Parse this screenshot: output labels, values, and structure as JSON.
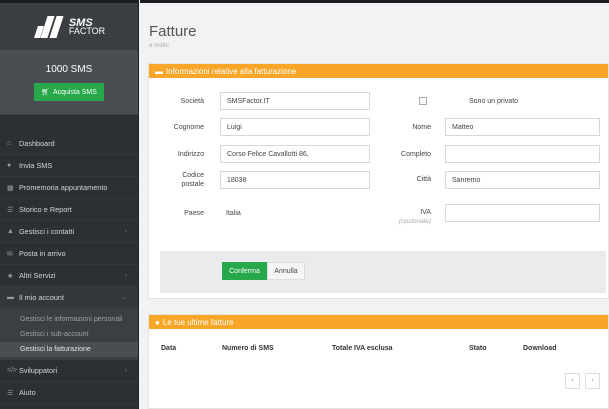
{
  "brand": {
    "line1": "SMS",
    "line2": "FACTOR"
  },
  "credits": {
    "count": "1000 SMS",
    "buy_label": "Acquista SMS"
  },
  "nav": [
    {
      "label": "Dashboard",
      "icon": "home-icon"
    },
    {
      "label": "Invia SMS",
      "icon": "chat-icon"
    },
    {
      "label": "Promemoria appuntamento",
      "icon": "calendar-icon"
    },
    {
      "label": "Storico e Report",
      "icon": "list-icon"
    },
    {
      "label": "Gestisci i contatti",
      "icon": "user-icon"
    },
    {
      "label": "Posta in arrivo",
      "icon": "mail-icon"
    },
    {
      "label": "Altri Servizi",
      "icon": "star-icon"
    },
    {
      "label": "Il mio account",
      "icon": "card-icon"
    }
  ],
  "subnav": [
    {
      "label": "Gestisci le informazioni personali"
    },
    {
      "label": "Gestisci i sub-account"
    },
    {
      "label": "Gestisci la fatturazione"
    }
  ],
  "nav_bottom": [
    {
      "label": "Sviluppatori",
      "icon": "code-icon"
    },
    {
      "label": "Aiuto",
      "icon": "help-icon"
    }
  ],
  "page": {
    "title": "Fatture",
    "subtitle": "e ordini"
  },
  "billing": {
    "header": "Informazioni relative alla fatturazione",
    "societa_label": "Società",
    "societa_value": "SMSFactor.IT",
    "privato_label": "Sono un privato",
    "cognome_label": "Cognome",
    "cognome_value": "Luigi",
    "nome_label": "Nome",
    "nome_value": "Matteo",
    "indirizzo_label": "Indirizzo",
    "indirizzo_value": "Corso Felice Cavallotti 86,",
    "completo_label": "Completo",
    "completo_value": "",
    "cap_label1": "Codice",
    "cap_label2": "postale",
    "cap_value": "18038",
    "citta_label": "Città",
    "citta_value": "Sanremo",
    "paese_label": "Paese",
    "paese_value": "Italia",
    "iva_label": "IVA",
    "iva_optional": "(opzionale)",
    "iva_value": "",
    "confirm_label": "Conferma",
    "cancel_label": "Annulla"
  },
  "invoices": {
    "header": "Le tue ultime fatture",
    "columns": [
      "Data",
      "Numero di SMS",
      "Totale IVA esclusa",
      "Stato",
      "Download"
    ],
    "prev": "‹",
    "next": "›"
  },
  "colors": {
    "accent": "#f7a628",
    "green": "#27a84a",
    "sidebar": "#2c2f33"
  }
}
